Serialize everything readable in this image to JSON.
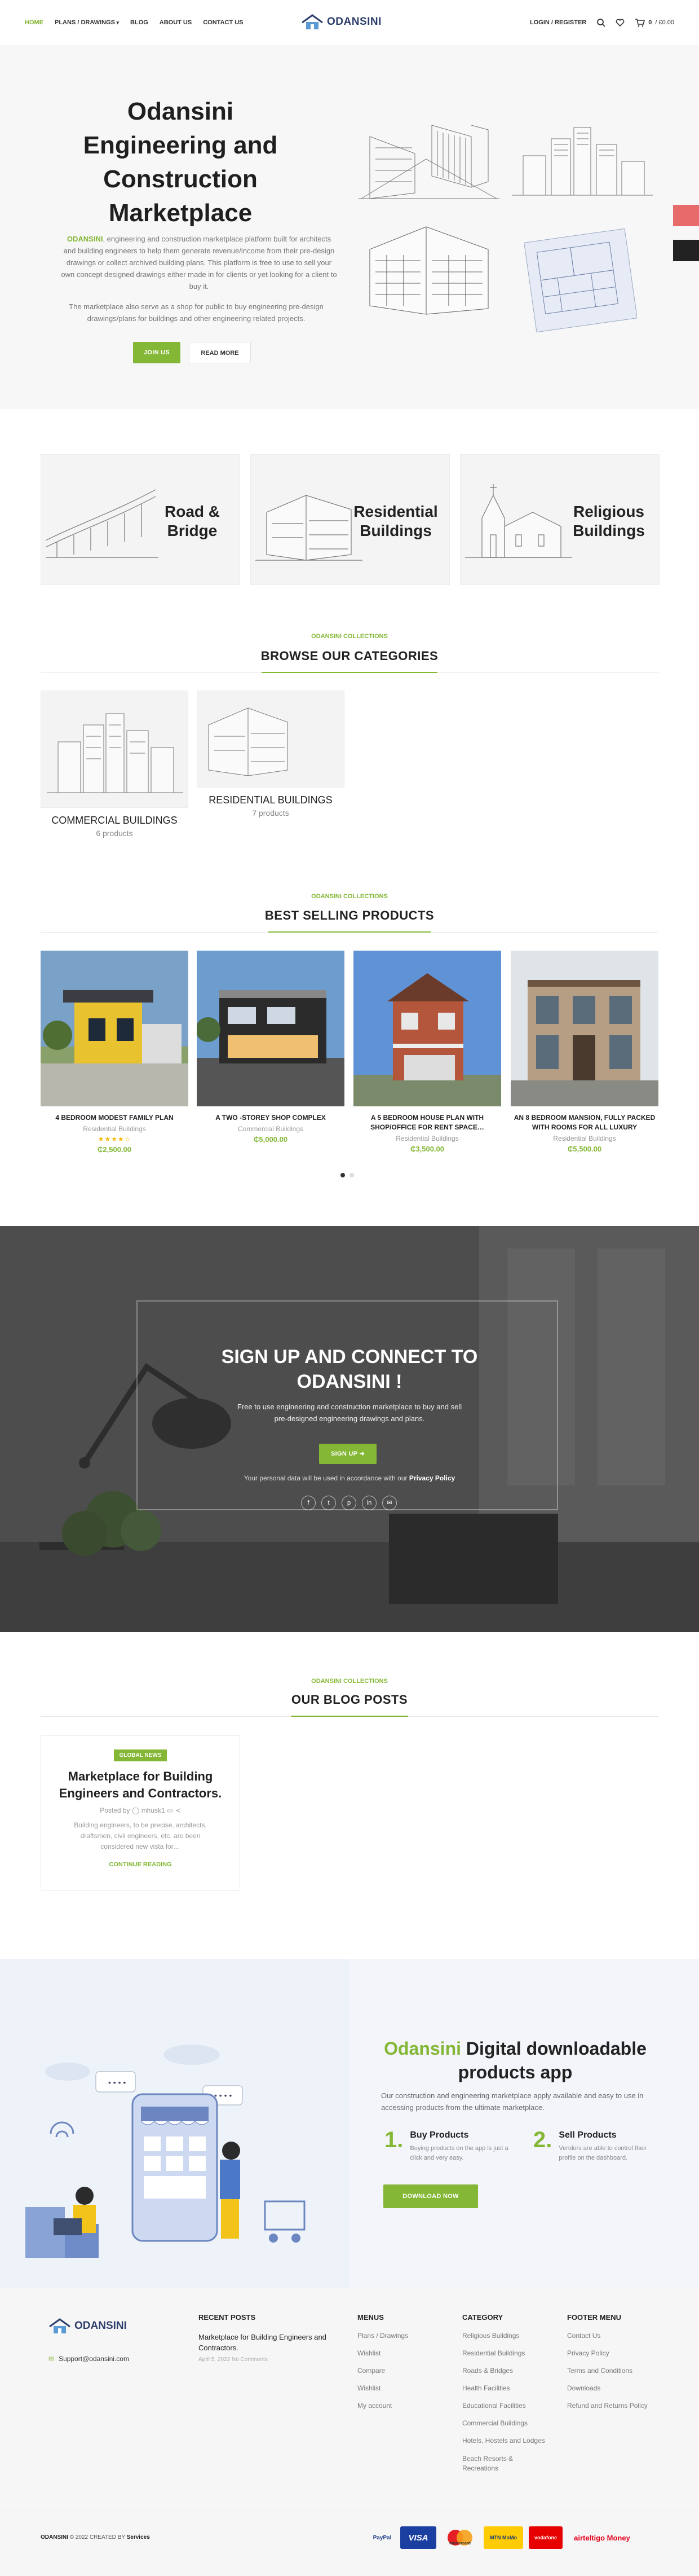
{
  "header": {
    "nav": [
      {
        "label": "HOME",
        "active": true
      },
      {
        "label": "PLANS / DRAWINGS",
        "dropdown": true
      },
      {
        "label": "BLOG"
      },
      {
        "label": "ABOUT US"
      },
      {
        "label": "CONTACT US"
      }
    ],
    "logo_text": "ODANSINI",
    "login": "LOGIN / REGISTER",
    "cart_count": "0",
    "cart_total": "/ £0.00"
  },
  "hero": {
    "title": "Odansini Engineering and Construction Marketplace",
    "brand": "ODANSINI",
    "p1": ", engineering and construction marketplace platform built for architects and building engineers to help them generate revenue/income from their pre-design drawings or collect archived building plans. This platform is free to use to sell your own concept designed drawings either made in for clients or yet looking for a client to buy it.",
    "p2": "The marketplace also serve as a shop for public to buy engineering pre-design drawings/plans for buildings and other engineering related projects.",
    "btn_join": "JOIN US",
    "btn_read": "READ MORE"
  },
  "tiles": [
    {
      "label": "Road & Bridge"
    },
    {
      "label": "Residential Buildings"
    },
    {
      "label": "Religious Buildings"
    }
  ],
  "categories": {
    "kicker": "ODANSINI COLLECTIONS",
    "title": "BROWSE OUR CATEGORIES",
    "items": [
      {
        "name": "COMMERCIAL BUILDINGS",
        "count": "6 products"
      },
      {
        "name": "RESIDENTIAL BUILDINGS",
        "count": "7 products"
      }
    ]
  },
  "products": {
    "kicker": "ODANSINI COLLECTIONS",
    "title": "BEST SELLING PRODUCTS",
    "items": [
      {
        "name": "4 BEDROOM MODEST FAMILY PLAN",
        "category": "Residential Buildings",
        "price": "₵2,500.00",
        "rating": 4,
        "stars": "★★★★☆"
      },
      {
        "name": "A TWO -STOREY SHOP COMPLEX",
        "category": "Commercial Buildings",
        "price": "₵5,000.00"
      },
      {
        "name": "A 5 BEDROOM HOUSE PLAN WITH SHOP/OFFICE FOR RENT SPACE…",
        "category": "Residential Buildings",
        "price": "₵3,500.00"
      },
      {
        "name": "AN 8 BEDROOM MANSION, FULLY PACKED WITH ROOMS FOR ALL LUXURY",
        "category": "Residential Buildings",
        "price": "₵5,500.00"
      }
    ]
  },
  "signup": {
    "title": "SIGN UP AND CONNECT TO ODANSINI !",
    "text": "Free to use engineering and construction marketplace to buy and sell pre-designed engineering drawings and plans.",
    "btn": "SIGN UP ➜",
    "privacy_pre": "Your personal data will be used in accordance with our",
    "privacy_link": "Privacy Policy",
    "social": [
      "f",
      "t",
      "p",
      "in",
      "✉"
    ]
  },
  "blog": {
    "kicker": "ODANSINI COLLECTIONS",
    "title": "OUR BLOG POSTS",
    "post": {
      "tag": "GLOBAL NEWS",
      "title": "Marketplace for Building Engineers and Contractors.",
      "meta": "Posted by",
      "author": "mhusk1",
      "excerpt": "Building engineers, to be precise, architects, draftsmen, civil engineers, etc. are been considered new vista for…",
      "more": "CONTINUE READING"
    }
  },
  "app": {
    "title_brand": "Odansini",
    "title_rest": " Digital downloadable products app",
    "text": "Our construction and engineering marketplace apply available and easy to use in accessing products from the ultimate marketplace.",
    "steps": [
      {
        "num": "1.",
        "title": "Buy Products",
        "desc": "Buying products on the app is just a click and very easy."
      },
      {
        "num": "2.",
        "title": "Sell Products",
        "desc": "Vendors are able to control their profile on the dashboard."
      }
    ],
    "btn": "DOWNLOAD NOW"
  },
  "footer": {
    "logo_text": "ODANSINI",
    "email": "Support@odansini.com",
    "recent_heading": "RECENT POSTS",
    "recent": {
      "title": "Marketplace for Building Engineers and Contractors.",
      "date": "April 5, 2022  No Comments"
    },
    "menus_heading": "MENUS",
    "menus": [
      "Plans / Drawings",
      "Wishlist",
      "Compare",
      "Wishlist",
      "My account"
    ],
    "cat_heading": "CATEGORY",
    "categories": [
      "Religious Buildings",
      "Residential Buildings",
      "Roads & Bridges",
      "Health Facilities",
      "Educational Facilities",
      "Commercial Buildings",
      "Hotels, Hostels and Lodges",
      "Beach Resorts & Recreations"
    ],
    "footer_heading": "FOOTER MENU",
    "footer_menu": [
      "Contact Us",
      "Privacy Policy",
      "Terms and Conditions",
      "Downloads",
      "Refund and Returns Policy"
    ],
    "copyright_brand": "ODANSINI",
    "copyright_rest": " © 2022 CREATED BY",
    "copyright_by": "Services",
    "payments": [
      "PayPal",
      "VISA",
      "mastercard",
      "MTN MoMo",
      "vodafone",
      "airteltigo Money"
    ]
  },
  "colors": {
    "accent": "#83b735",
    "dark": "#222222",
    "hero_bg": "#f7f7f7",
    "app_bg": "#f3f5fa"
  }
}
